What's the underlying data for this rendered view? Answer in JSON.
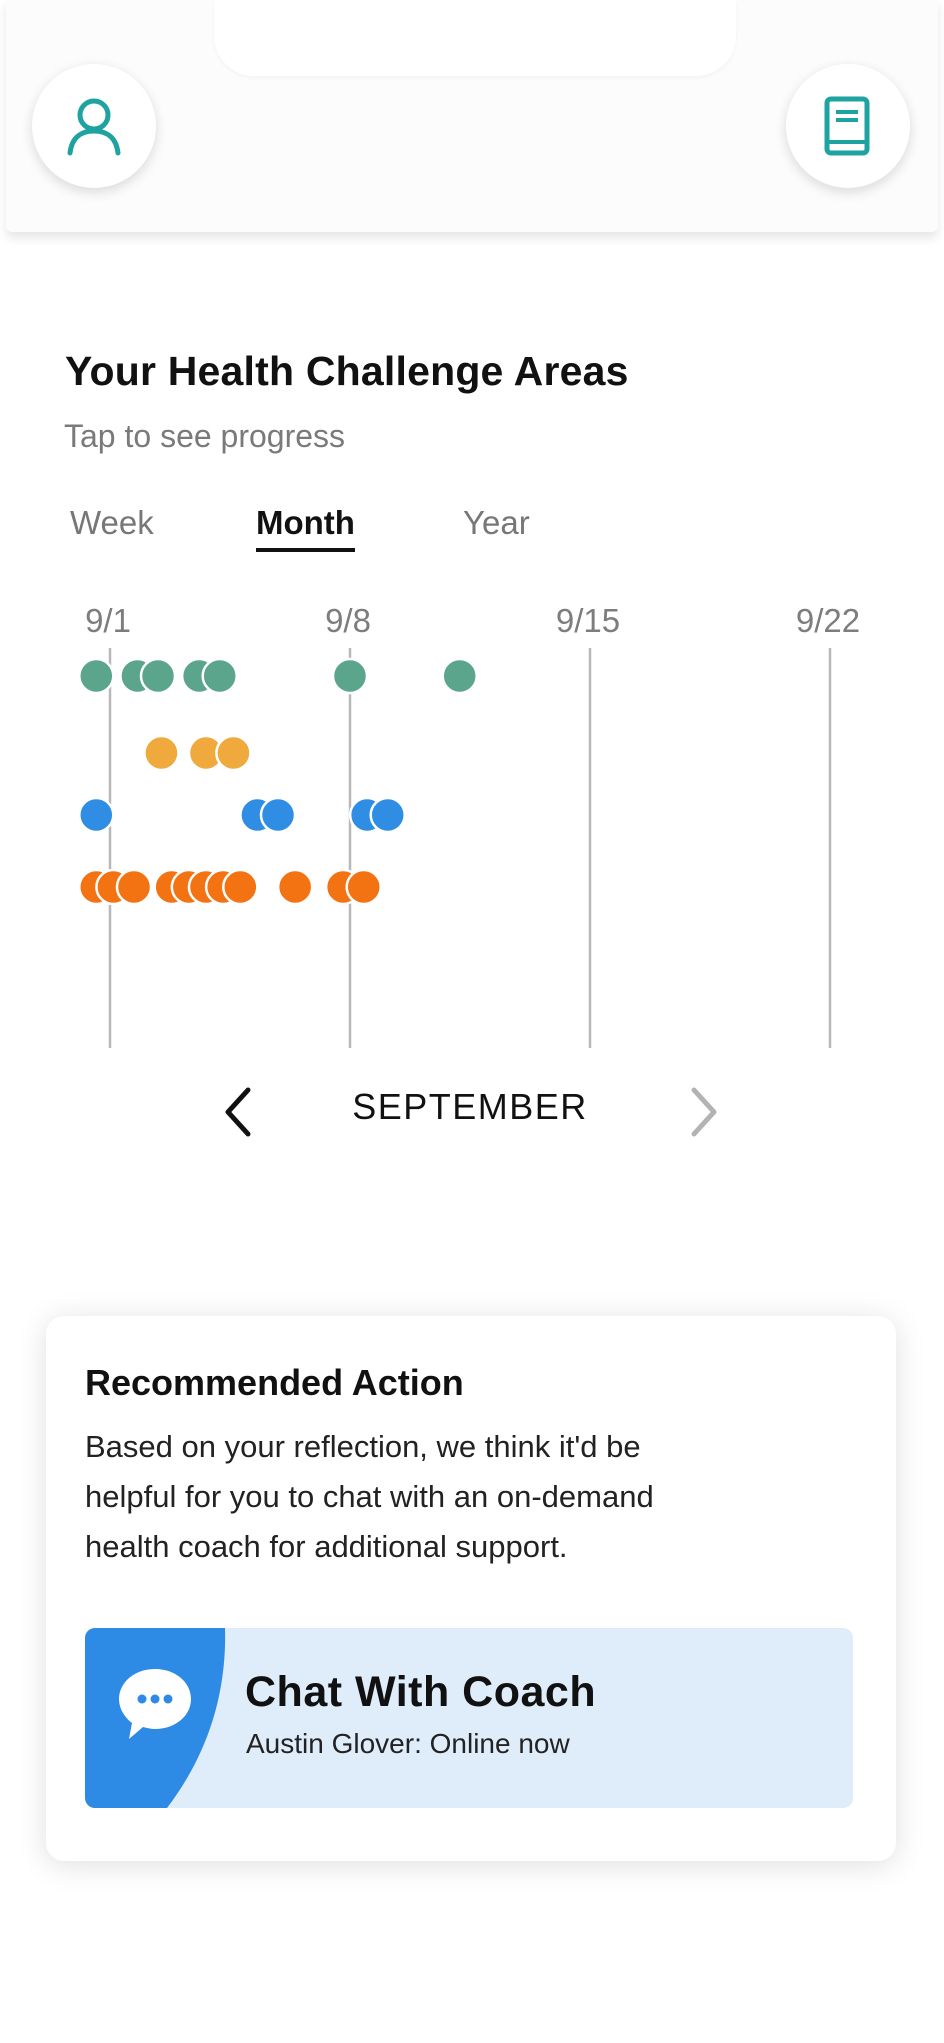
{
  "header": {
    "profile_icon": "person-icon",
    "journal_icon": "book-icon",
    "accent_color": "#1fa3a0"
  },
  "challenge": {
    "title": "Your Health Challenge Areas",
    "subtitle": "Tap to see progress"
  },
  "tabs": [
    {
      "label": "Week",
      "active": false
    },
    {
      "label": "Month",
      "active": true
    },
    {
      "label": "Year",
      "active": false
    }
  ],
  "chart_data": {
    "type": "scatter",
    "x_tick_labels": [
      "9/1",
      "9/8",
      "9/15",
      "9/22"
    ],
    "x_ticks": [
      1,
      8,
      15,
      22
    ],
    "xlim": [
      1,
      24
    ],
    "series": [
      {
        "color": "#5aa58c",
        "x": [
          0.6,
          1.8,
          2.4,
          3.6,
          4.2,
          8.0,
          11.2
        ]
      },
      {
        "color": "#f0a93d",
        "x": [
          2.5,
          3.8,
          4.6
        ]
      },
      {
        "color": "#2f8ee4",
        "x": [
          0.6,
          5.3,
          5.9,
          8.5,
          9.1
        ]
      },
      {
        "color": "#f37212",
        "x": [
          0.6,
          1.1,
          1.7,
          2.8,
          3.3,
          3.8,
          4.3,
          4.8,
          6.4,
          7.8,
          8.4
        ]
      }
    ]
  },
  "month_nav": {
    "label": "SEPTEMBER",
    "prev_icon": "chevron-left-icon",
    "next_icon": "chevron-right-icon"
  },
  "recommended": {
    "title": "Recommended Action",
    "line1": "Based on your reflection, we think it'd be",
    "line2": "helpful for you to chat with an on-demand",
    "line3": "health coach for additional support.",
    "chat_title": "Chat With Coach",
    "chat_subtitle": "Austin Glover: Online now",
    "chat_icon": "chat-bubble-icon",
    "chat_color": "#2d8ae5"
  }
}
